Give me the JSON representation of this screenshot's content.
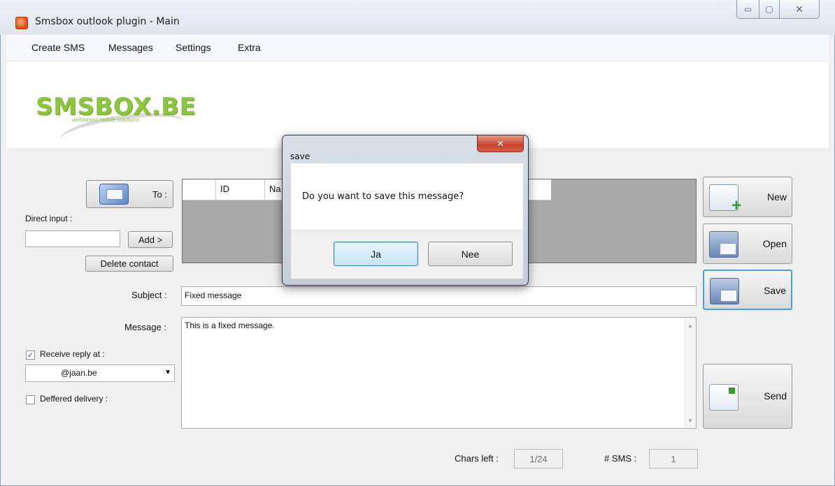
{
  "window": {
    "title": "Smsbox outlook plugin - Main",
    "controls": {
      "minimize": "▭",
      "maximize": "▢",
      "close": "✕"
    }
  },
  "menu": [
    "Create SMS",
    "Messages",
    "Settings",
    "Extra"
  ],
  "logo": {
    "text": "SMSBOX.BE",
    "tagline": "webbased mobile solutions"
  },
  "recipients": {
    "to_label": "To :",
    "direct_input_label": "Direct input :",
    "direct_input_value": "",
    "add_label": "Add >",
    "delete_label": "Delete contact",
    "columns": [
      "",
      "ID",
      "Na"
    ]
  },
  "form": {
    "subject_label": "Subject :",
    "subject_value": "Fixed message",
    "message_label": "Message :",
    "message_value": "This is a fixed message.",
    "receive_reply_label": "Receive reply at :",
    "receive_reply_checked": true,
    "reply_address": "@jaan.be",
    "deferred_label": "Deffered delivery :",
    "deferred_checked": false,
    "chars_left_label": "Chars left :",
    "chars_left_value": "1/24",
    "sms_count_label": "# SMS :",
    "sms_count_value": "1"
  },
  "actions": {
    "new": "New",
    "open": "Open",
    "save": "Save",
    "send": "Send"
  },
  "dialog": {
    "title": "save",
    "message": "Do you want to save this message?",
    "yes": "Ja",
    "no": "Nee",
    "close": "✕"
  }
}
